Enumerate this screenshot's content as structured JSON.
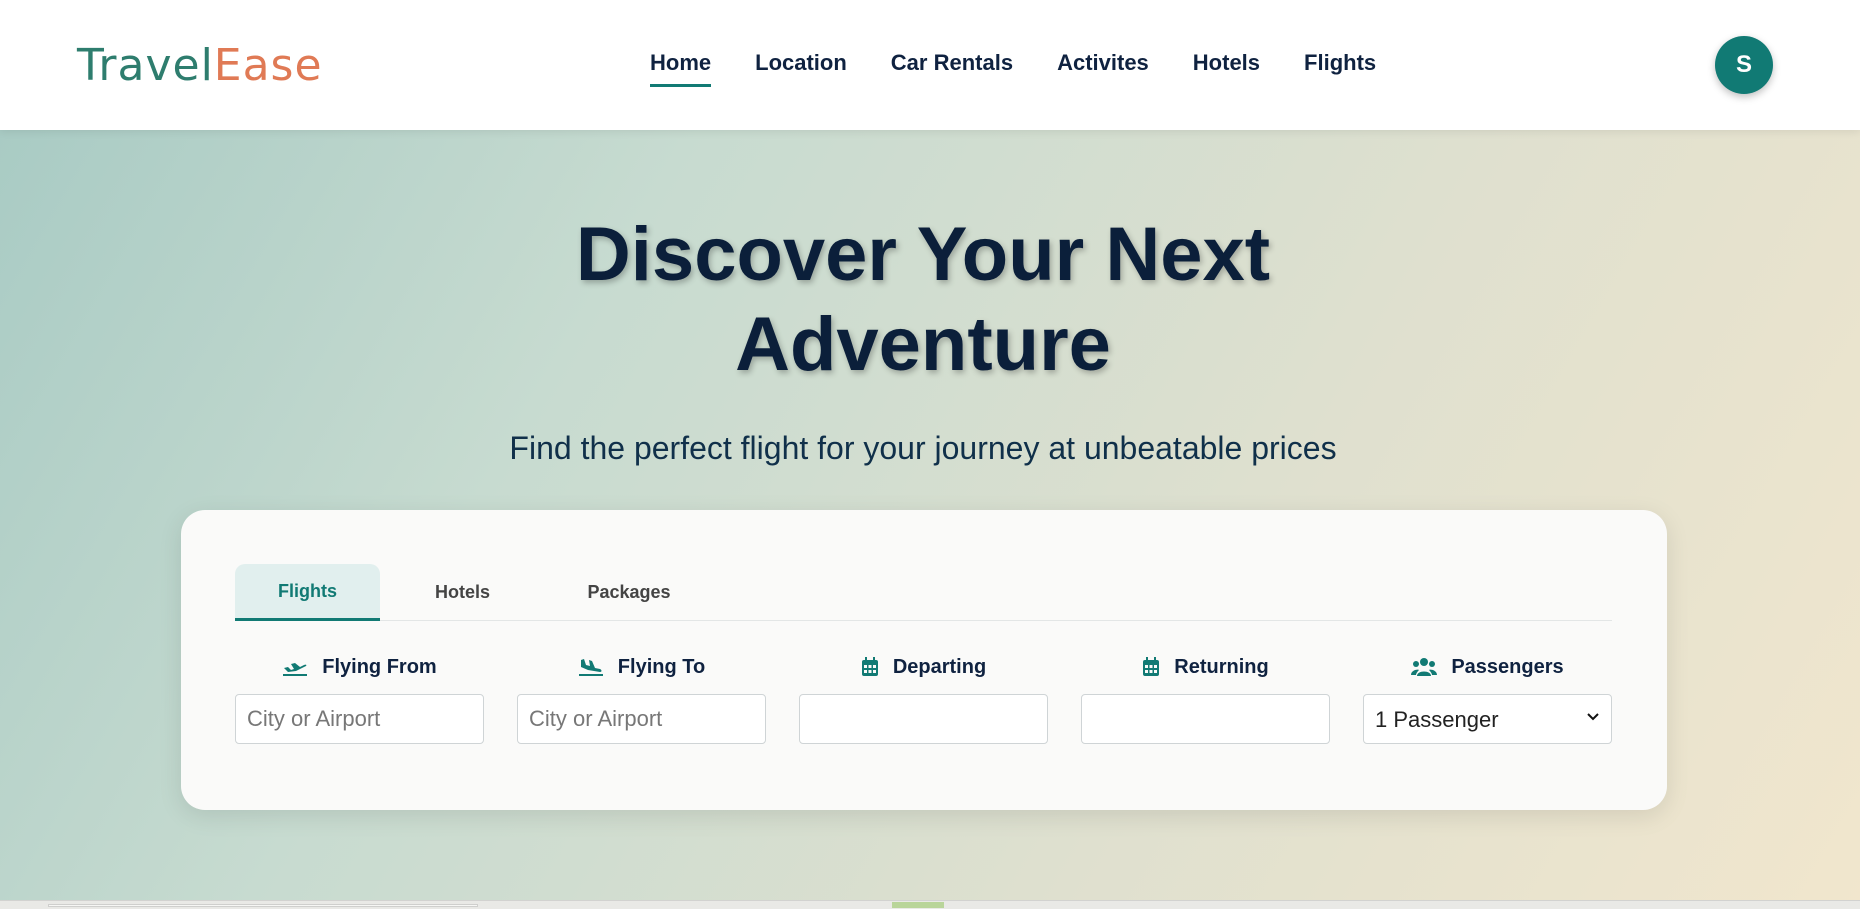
{
  "brand": {
    "logo_part1": "Travel",
    "logo_part2": "Ease",
    "logo_color_1": "#2e7d6e",
    "logo_color_2": "#e07a55"
  },
  "nav": {
    "items": [
      {
        "label": "Home",
        "active": true
      },
      {
        "label": "Location",
        "active": false
      },
      {
        "label": "Car Rentals",
        "active": false
      },
      {
        "label": "Activites",
        "active": false
      },
      {
        "label": "Hotels",
        "active": false
      },
      {
        "label": "Flights",
        "active": false
      }
    ]
  },
  "user": {
    "avatar_initial": "S"
  },
  "hero": {
    "title_line1": "Discover Your Next",
    "title_line2": "Adventure",
    "subtitle": "Find the perfect flight for your journey at unbeatable prices"
  },
  "search": {
    "tabs": [
      {
        "label": "Flights",
        "active": true
      },
      {
        "label": "Hotels",
        "active": false
      },
      {
        "label": "Packages",
        "active": false
      }
    ],
    "fields": {
      "from": {
        "label": "Flying From",
        "icon": "plane-departure-icon",
        "placeholder": "City or Airport",
        "value": ""
      },
      "to": {
        "label": "Flying To",
        "icon": "plane-arrival-icon",
        "placeholder": "City or Airport",
        "value": ""
      },
      "departing": {
        "label": "Departing",
        "icon": "calendar-icon",
        "value": ""
      },
      "returning": {
        "label": "Returning",
        "icon": "calendar-icon",
        "value": ""
      },
      "passengers": {
        "label": "Passengers",
        "icon": "users-icon",
        "selected": "1 Passenger"
      }
    }
  },
  "colors": {
    "accent": "#117a74",
    "heading": "#0b1f3a"
  }
}
